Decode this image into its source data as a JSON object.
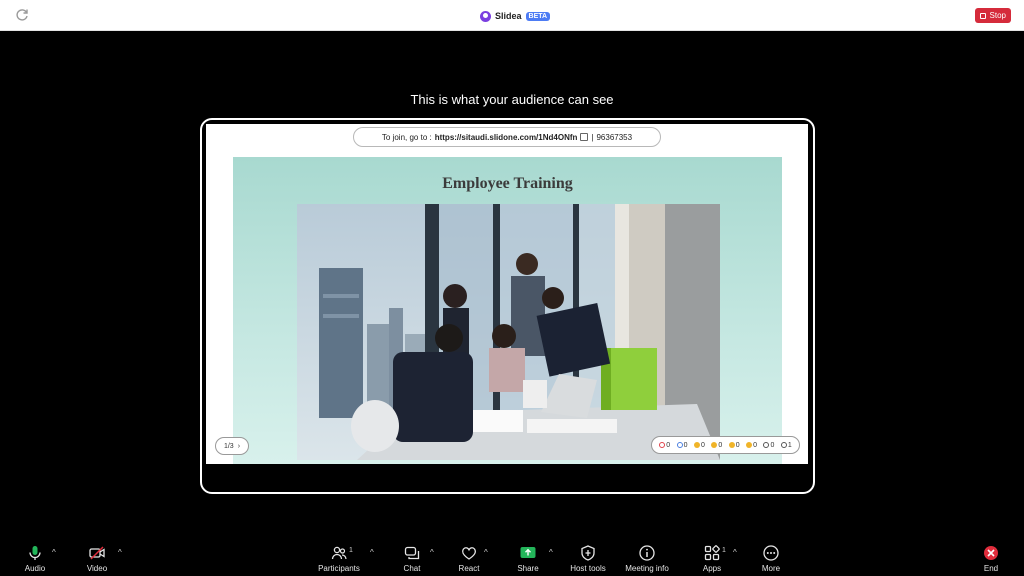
{
  "app": {
    "name": "Slidea",
    "badge": "BETA",
    "stop_label": "Stop"
  },
  "headline": "This is what your audience can see",
  "join": {
    "prefix": "To join, go to :",
    "url": "https://sitaudi.slidone.com/1Nd4ONfn",
    "separator": "|",
    "code": "96367353"
  },
  "slide": {
    "title": "Employee Training",
    "page": "1/3"
  },
  "reactions": [
    {
      "icon": "heart-icon",
      "color": "#e0424a",
      "count": "0"
    },
    {
      "icon": "like-icon",
      "color": "#4a7fe0",
      "count": "0"
    },
    {
      "icon": "laugh-icon",
      "color": "#f0b429",
      "count": "0"
    },
    {
      "icon": "wow-icon",
      "color": "#f0b429",
      "count": "0"
    },
    {
      "icon": "clap-icon",
      "color": "#f0b429",
      "count": "0"
    },
    {
      "icon": "angry-icon",
      "color": "#f0b429",
      "count": "0"
    },
    {
      "icon": "hand-icon",
      "color": "#555555",
      "count": "0"
    },
    {
      "icon": "users-icon",
      "color": "#555555",
      "count": "1"
    }
  ],
  "toolbar": {
    "audio": "Audio",
    "video": "Video",
    "participants": "Participants",
    "participants_count": "1",
    "chat": "Chat",
    "react": "React",
    "share": "Share",
    "host_tools": "Host tools",
    "meeting_info": "Meeting info",
    "apps": "Apps",
    "apps_count": "1",
    "more": "More",
    "end": "End"
  },
  "colors": {
    "stop": "#d52b3b",
    "share": "#23b55a",
    "end": "#e02d3c",
    "slide_bg": "#a8d9d0"
  }
}
